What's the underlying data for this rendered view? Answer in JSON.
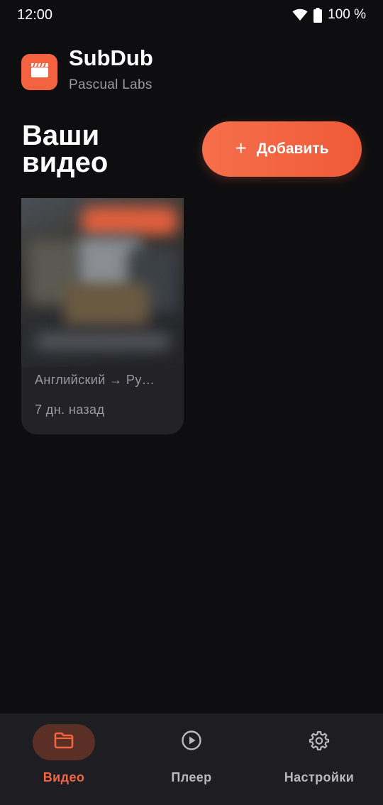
{
  "status_bar": {
    "time": "12:00",
    "battery": "100 %",
    "icons": [
      "wifi-icon",
      "battery-icon"
    ]
  },
  "app": {
    "name": "SubDub",
    "developer": "Pascual Labs",
    "logo_icon": "clapperboard-icon",
    "accent_color": "#f4633f"
  },
  "main": {
    "title": "Ваши видео",
    "add_button": {
      "label": "Добавить",
      "icon": "plus-icon"
    },
    "videos": [
      {
        "languages": "Английский → Ру…",
        "date": "7 дн. назад"
      }
    ]
  },
  "bottom_nav": {
    "items": [
      {
        "label": "Видео",
        "icon": "folder-icon",
        "active": true
      },
      {
        "label": "Плеер",
        "icon": "play-circle-icon",
        "active": false
      },
      {
        "label": "Настройки",
        "icon": "gear-icon",
        "active": false
      }
    ]
  }
}
